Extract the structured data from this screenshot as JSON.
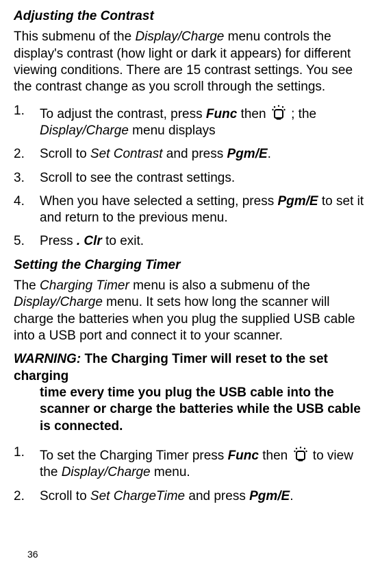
{
  "section1": {
    "heading": "Adjusting the Contrast",
    "intro": {
      "t1": "This submenu of the ",
      "i1": "Display/Charge",
      "t2": " menu controls the display's contrast (how light or dark it appears) for different viewing conditions. There are 15 contrast settings. You see the contrast change as you scroll through the settings."
    },
    "steps": [
      {
        "num": "1.",
        "t1": "To adjust the contrast, press ",
        "bi1": "Func",
        "t2": " then ",
        "t3": " ; the ",
        "i1": "Display/Charge",
        "t4": " menu displays"
      },
      {
        "num": "2.",
        "t1": "Scroll to ",
        "i1": "Set Contrast",
        "t2": " and press ",
        "bi1": "Pgm/E",
        "t3": "."
      },
      {
        "num": "3.",
        "t1": "Scroll to see the contrast settings."
      },
      {
        "num": "4.",
        "t1": "When you have selected a setting, press ",
        "bi1": "Pgm/E",
        "t2": " to set it and return to the previous menu."
      },
      {
        "num": "5.",
        "t1": "Press ",
        "bi1": ". Clr",
        "t2": " to exit."
      }
    ]
  },
  "section2": {
    "heading": "Setting the Charging Timer",
    "intro": {
      "t1": "The ",
      "i1": "Charging Timer",
      "t2": " menu is also a submenu of the ",
      "i2": "Display/Charge",
      "t3": " menu. It sets how long the scanner will charge the batteries when you plug the supplied USB cable into a USB port and connect it to your scanner."
    },
    "warning": {
      "label": "WARNING:  ",
      "body": "The Charging Timer will reset to the set charging time every time you plug the USB cable into the scanner or charge the batteries while the USB cable is connected."
    },
    "steps": [
      {
        "num": "1.",
        "t1": "To set the Charging Timer press ",
        "bi1": "Func",
        "t2": " then ",
        "t3": " to view the ",
        "i1": "Display/Charge",
        "t4": " menu."
      },
      {
        "num": "2.",
        "t1": "Scroll to ",
        "i1": "Set ChargeTime",
        "t2": " and press ",
        "bi1": "Pgm/E",
        "t3": "."
      }
    ]
  },
  "pageNumber": "36"
}
